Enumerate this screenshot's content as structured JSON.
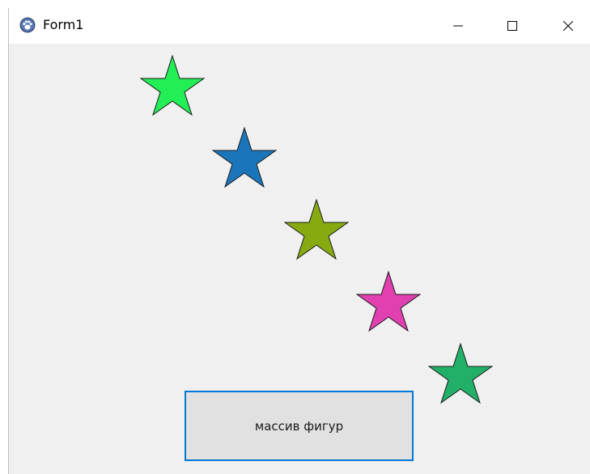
{
  "window": {
    "title": "Form1",
    "app_icon": "paw-icon"
  },
  "caption_buttons": {
    "minimize_icon": "minimize-icon",
    "maximize_icon": "maximize-icon",
    "close_icon": "close-icon"
  },
  "canvas": {
    "stars": [
      {
        "color": "#22ee55"
      },
      {
        "color": "#1b75bb"
      },
      {
        "color": "#88aa11"
      },
      {
        "color": "#e040b0"
      },
      {
        "color": "#22b068"
      }
    ]
  },
  "action_button": {
    "label": "массив фигур"
  },
  "colors": {
    "accent": "#0078d7",
    "form_background": "#f0f0f0"
  }
}
